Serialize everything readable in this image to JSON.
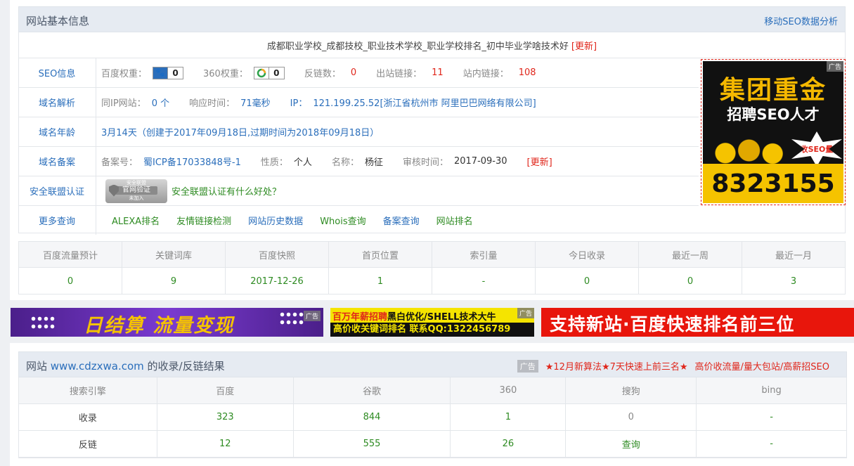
{
  "basic_info": {
    "panel_title": "网站基本信息",
    "mobile_link": "移动SEO数据分析",
    "site_title": "成都职业学校_成都技校_职业技术学校_职业学校排名_初中毕业学啥技术好",
    "update_label": "[更新]",
    "seo": {
      "label": "SEO信息",
      "baidu_weight_label": "百度权重：",
      "baidu_weight": "0",
      "weight360_label": "360权重：",
      "weight360": "0",
      "backlinks_label": "反链数：",
      "backlinks": "0",
      "outbound_label": "出站链接：",
      "outbound": "11",
      "internal_label": "站内链接：",
      "internal": "108"
    },
    "dns": {
      "label": "域名解析",
      "same_ip_label": "同IP网站：",
      "same_ip": "0 个",
      "response_label": "响应时间：",
      "response": "71毫秒",
      "ip_label": "IP：",
      "ip": "121.199.25.52[浙江省杭州市 阿里巴巴网络有限公司]"
    },
    "age": {
      "label": "域名年龄",
      "value": "3月14天（创建于2017年09月18日,过期时间为2018年09月18日）"
    },
    "icp": {
      "label": "域名备案",
      "number_label": "备案号：",
      "number": "蜀ICP备17033848号-1",
      "nature_label": "性质：",
      "nature": "个人",
      "name_label": "名称：",
      "name": "杨征",
      "audit_label": "审核时间：",
      "audit": "2017-09-30",
      "update_label": "[更新]"
    },
    "security": {
      "label": "安全联盟认证",
      "badge_top": "安全联盟",
      "badge_main": "官网验证",
      "badge_sub": "未加入",
      "link": "安全联盟认证有什么好处？"
    },
    "more": {
      "label": "更多查询",
      "links": [
        "ALEXA排名",
        "友情链接检测",
        "网站历史数据",
        "Whois查询",
        "备案查询",
        "网站排名"
      ]
    }
  },
  "side_ad": {
    "tag": "广告",
    "line1": "集团重金",
    "line2": "招聘SEO人才",
    "badge": "收SEO量",
    "number": "8323155"
  },
  "stats": {
    "headers": [
      "百度流量预计",
      "关键词库",
      "百度快照",
      "首页位置",
      "索引量",
      "今日收录",
      "最近一周",
      "最近一月"
    ],
    "values": [
      "0",
      "9",
      "2017-12-26",
      "1",
      "-",
      "0",
      "0",
      "3"
    ]
  },
  "banners": {
    "tag": "广告",
    "b1": "日结算 流量变现",
    "b2_line1a": "百万年薪招聘",
    "b2_line1b": "黑白优化/SHELL技术大牛",
    "b2_line2": "高价收关键词排名  联系QQ:1322456789",
    "b3": "支持新站·百度快速排名前三位"
  },
  "index_results": {
    "title_prefix": "网站 ",
    "domain": "www.cdzxwa.com",
    "title_suffix": " 的收录/反链结果",
    "ad_label": "广告",
    "ad1": "★12月新算法★7天快速上前三名★",
    "ad2": "高价收流量/量大包站/高薪招SEO",
    "headers": [
      "搜索引擎",
      "百度",
      "谷歌",
      "360",
      "搜狗",
      "bing"
    ],
    "rows": [
      {
        "name": "收录",
        "cells": [
          "323",
          "844",
          "1",
          "0",
          "-"
        ]
      },
      {
        "name": "反链",
        "cells": [
          "12",
          "555",
          "26",
          "查询",
          "-"
        ]
      }
    ]
  },
  "colors": {
    "link_blue": "#2a6ebb",
    "red": "#e0261b",
    "green": "#2e8b22",
    "header_bg": "#e6ebf2"
  }
}
